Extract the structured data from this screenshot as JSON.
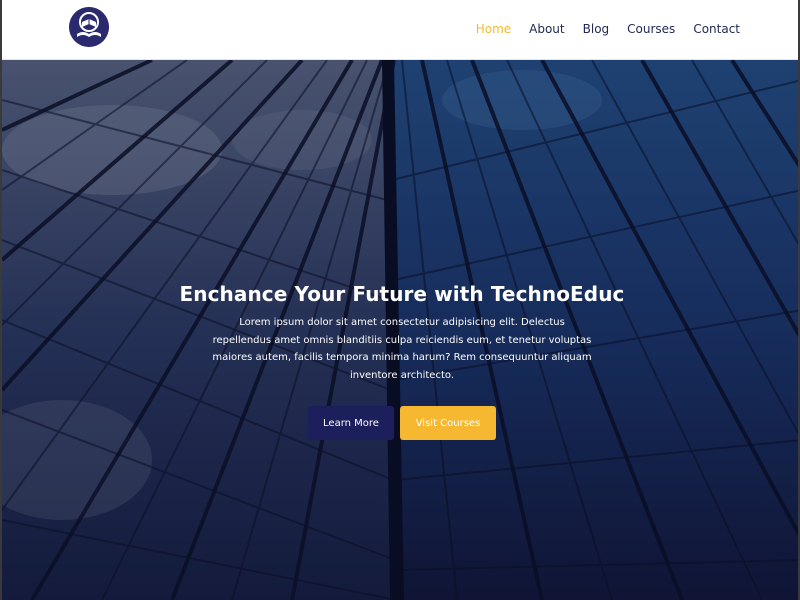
{
  "brand": {
    "logo_icon": "book-logo-icon",
    "colors": {
      "navy": "#2c2a6e",
      "accent": "#f5b82e"
    }
  },
  "nav": {
    "items": [
      {
        "label": "Home",
        "active": true
      },
      {
        "label": "About",
        "active": false
      },
      {
        "label": "Blog",
        "active": false
      },
      {
        "label": "Courses",
        "active": false
      },
      {
        "label": "Contact",
        "active": false
      }
    ]
  },
  "hero": {
    "title": "Enchance Your Future with TechnoEduc",
    "text": "Lorem ipsum dolor sit amet consectetur adipisicing elit. Delectus repellendus amet omnis blanditiis culpa reiciendis eum, et tenetur voluptas maiores autem, facilis tempora minima harum? Rem consequuntur aliquam inventore architecto.",
    "primary_button": "Learn More",
    "secondary_button": "Visit Courses",
    "background": "glass-skyscraper-photo"
  }
}
